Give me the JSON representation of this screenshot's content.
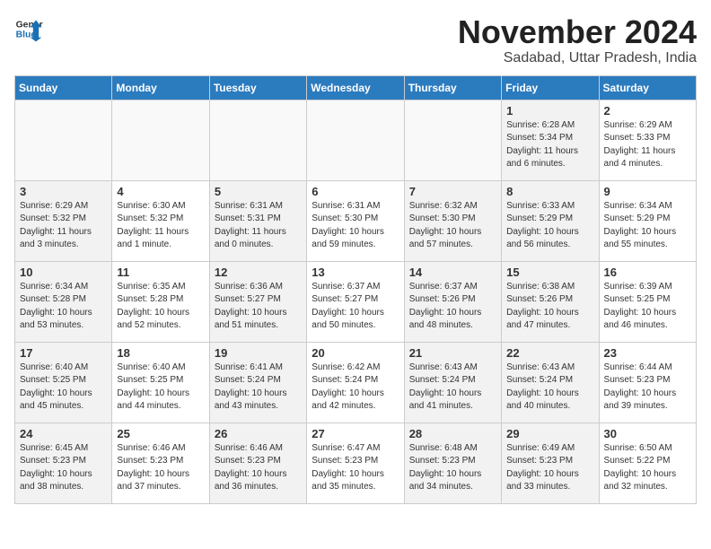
{
  "logo": {
    "line1": "General",
    "line2": "Blue"
  },
  "header": {
    "month": "November 2024",
    "location": "Sadabad, Uttar Pradesh, India"
  },
  "weekdays": [
    "Sunday",
    "Monday",
    "Tuesday",
    "Wednesday",
    "Thursday",
    "Friday",
    "Saturday"
  ],
  "weeks": [
    [
      {
        "day": "",
        "info": "",
        "empty": true
      },
      {
        "day": "",
        "info": "",
        "empty": true
      },
      {
        "day": "",
        "info": "",
        "empty": true
      },
      {
        "day": "",
        "info": "",
        "empty": true
      },
      {
        "day": "",
        "info": "",
        "empty": true
      },
      {
        "day": "1",
        "info": "Sunrise: 6:28 AM\nSunset: 5:34 PM\nDaylight: 11 hours\nand 6 minutes.",
        "shaded": true
      },
      {
        "day": "2",
        "info": "Sunrise: 6:29 AM\nSunset: 5:33 PM\nDaylight: 11 hours\nand 4 minutes."
      }
    ],
    [
      {
        "day": "3",
        "info": "Sunrise: 6:29 AM\nSunset: 5:32 PM\nDaylight: 11 hours\nand 3 minutes.",
        "shaded": true
      },
      {
        "day": "4",
        "info": "Sunrise: 6:30 AM\nSunset: 5:32 PM\nDaylight: 11 hours\nand 1 minute."
      },
      {
        "day": "5",
        "info": "Sunrise: 6:31 AM\nSunset: 5:31 PM\nDaylight: 11 hours\nand 0 minutes.",
        "shaded": true
      },
      {
        "day": "6",
        "info": "Sunrise: 6:31 AM\nSunset: 5:30 PM\nDaylight: 10 hours\nand 59 minutes."
      },
      {
        "day": "7",
        "info": "Sunrise: 6:32 AM\nSunset: 5:30 PM\nDaylight: 10 hours\nand 57 minutes.",
        "shaded": true
      },
      {
        "day": "8",
        "info": "Sunrise: 6:33 AM\nSunset: 5:29 PM\nDaylight: 10 hours\nand 56 minutes.",
        "shaded": true
      },
      {
        "day": "9",
        "info": "Sunrise: 6:34 AM\nSunset: 5:29 PM\nDaylight: 10 hours\nand 55 minutes."
      }
    ],
    [
      {
        "day": "10",
        "info": "Sunrise: 6:34 AM\nSunset: 5:28 PM\nDaylight: 10 hours\nand 53 minutes.",
        "shaded": true
      },
      {
        "day": "11",
        "info": "Sunrise: 6:35 AM\nSunset: 5:28 PM\nDaylight: 10 hours\nand 52 minutes."
      },
      {
        "day": "12",
        "info": "Sunrise: 6:36 AM\nSunset: 5:27 PM\nDaylight: 10 hours\nand 51 minutes.",
        "shaded": true
      },
      {
        "day": "13",
        "info": "Sunrise: 6:37 AM\nSunset: 5:27 PM\nDaylight: 10 hours\nand 50 minutes."
      },
      {
        "day": "14",
        "info": "Sunrise: 6:37 AM\nSunset: 5:26 PM\nDaylight: 10 hours\nand 48 minutes.",
        "shaded": true
      },
      {
        "day": "15",
        "info": "Sunrise: 6:38 AM\nSunset: 5:26 PM\nDaylight: 10 hours\nand 47 minutes.",
        "shaded": true
      },
      {
        "day": "16",
        "info": "Sunrise: 6:39 AM\nSunset: 5:25 PM\nDaylight: 10 hours\nand 46 minutes."
      }
    ],
    [
      {
        "day": "17",
        "info": "Sunrise: 6:40 AM\nSunset: 5:25 PM\nDaylight: 10 hours\nand 45 minutes.",
        "shaded": true
      },
      {
        "day": "18",
        "info": "Sunrise: 6:40 AM\nSunset: 5:25 PM\nDaylight: 10 hours\nand 44 minutes."
      },
      {
        "day": "19",
        "info": "Sunrise: 6:41 AM\nSunset: 5:24 PM\nDaylight: 10 hours\nand 43 minutes.",
        "shaded": true
      },
      {
        "day": "20",
        "info": "Sunrise: 6:42 AM\nSunset: 5:24 PM\nDaylight: 10 hours\nand 42 minutes."
      },
      {
        "day": "21",
        "info": "Sunrise: 6:43 AM\nSunset: 5:24 PM\nDaylight: 10 hours\nand 41 minutes.",
        "shaded": true
      },
      {
        "day": "22",
        "info": "Sunrise: 6:43 AM\nSunset: 5:24 PM\nDaylight: 10 hours\nand 40 minutes.",
        "shaded": true
      },
      {
        "day": "23",
        "info": "Sunrise: 6:44 AM\nSunset: 5:23 PM\nDaylight: 10 hours\nand 39 minutes."
      }
    ],
    [
      {
        "day": "24",
        "info": "Sunrise: 6:45 AM\nSunset: 5:23 PM\nDaylight: 10 hours\nand 38 minutes.",
        "shaded": true
      },
      {
        "day": "25",
        "info": "Sunrise: 6:46 AM\nSunset: 5:23 PM\nDaylight: 10 hours\nand 37 minutes."
      },
      {
        "day": "26",
        "info": "Sunrise: 6:46 AM\nSunset: 5:23 PM\nDaylight: 10 hours\nand 36 minutes.",
        "shaded": true
      },
      {
        "day": "27",
        "info": "Sunrise: 6:47 AM\nSunset: 5:23 PM\nDaylight: 10 hours\nand 35 minutes."
      },
      {
        "day": "28",
        "info": "Sunrise: 6:48 AM\nSunset: 5:23 PM\nDaylight: 10 hours\nand 34 minutes.",
        "shaded": true
      },
      {
        "day": "29",
        "info": "Sunrise: 6:49 AM\nSunset: 5:23 PM\nDaylight: 10 hours\nand 33 minutes.",
        "shaded": true
      },
      {
        "day": "30",
        "info": "Sunrise: 6:50 AM\nSunset: 5:22 PM\nDaylight: 10 hours\nand 32 minutes."
      }
    ]
  ]
}
